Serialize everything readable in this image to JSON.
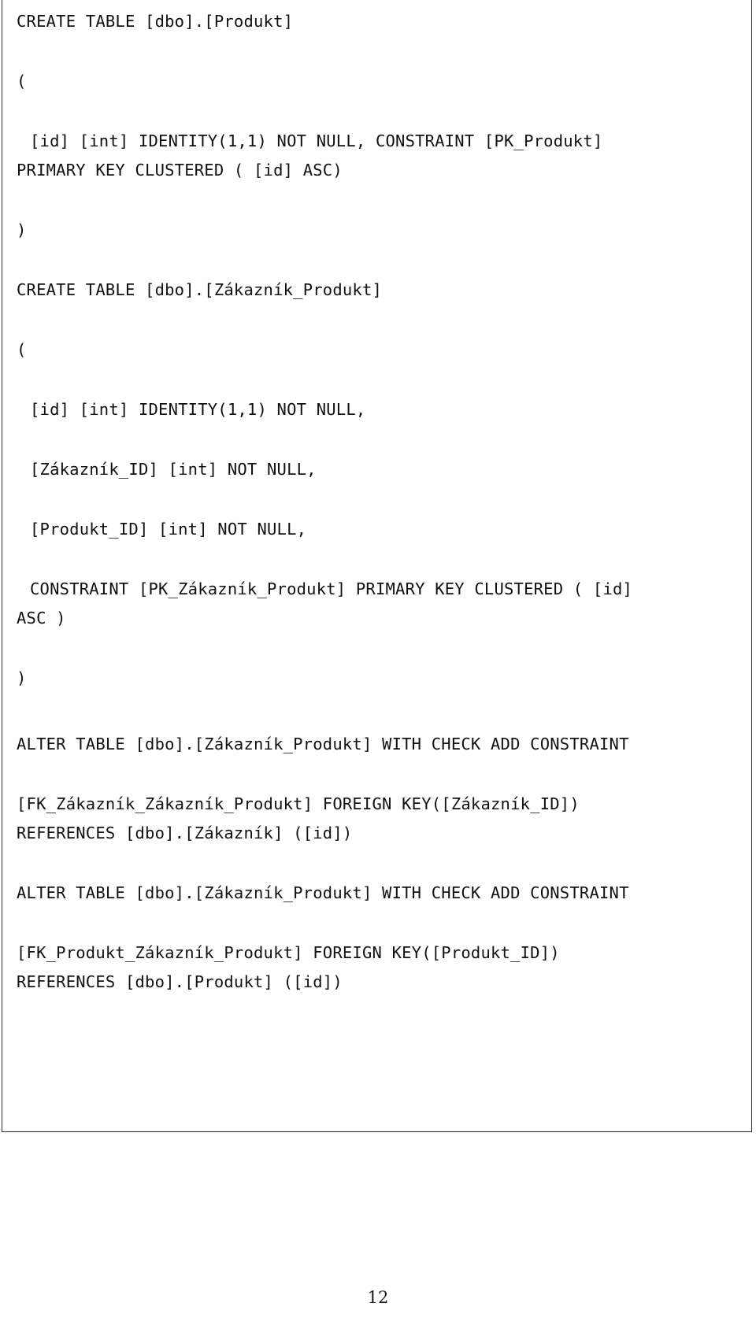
{
  "document": {
    "page_number": "12",
    "frame": {
      "border_color": "#2b2b2b",
      "background_color": "#ffffff"
    },
    "text_color": "#111111"
  },
  "code": {
    "language": "sql",
    "blocks": [
      {
        "name": "create-table-produkt",
        "lines": [
          {
            "text": "CREATE TABLE [dbo].[Produkt]",
            "indent": 0,
            "wrap": false
          },
          {
            "text": "(",
            "indent": 0,
            "wrap": false
          },
          {
            "text": "[id] [int] IDENTITY(1,1) NOT NULL, CONSTRAINT [PK_Produkt]",
            "indent": 1,
            "wrap": false
          },
          {
            "text": "PRIMARY KEY CLUSTERED ( [id] ASC)",
            "indent": 0,
            "wrap": true
          },
          {
            "text": ")",
            "indent": 0,
            "wrap": false
          }
        ]
      },
      {
        "name": "create-table-zakaznik-produkt",
        "lines": [
          {
            "text": "CREATE TABLE [dbo].[Zákazník_Produkt]",
            "indent": 0,
            "wrap": false
          },
          {
            "text": "(",
            "indent": 0,
            "wrap": false
          },
          {
            "text": "[id] [int] IDENTITY(1,1) NOT NULL,",
            "indent": 1,
            "wrap": false
          },
          {
            "text": "[Zákazník_ID] [int] NOT NULL,",
            "indent": 1,
            "wrap": false
          },
          {
            "text": "[Produkt_ID] [int] NOT NULL,",
            "indent": 1,
            "wrap": false
          },
          {
            "text": "CONSTRAINT [PK_Zákazník_Produkt] PRIMARY KEY CLUSTERED ( [id]",
            "indent": 1,
            "wrap": false
          },
          {
            "text": "ASC )",
            "indent": 0,
            "wrap": true
          },
          {
            "text": ")",
            "indent": 0,
            "wrap": false
          }
        ]
      },
      {
        "name": "alter-table-fk-zakaznik",
        "lines": [
          {
            "text": "ALTER TABLE [dbo].[Zákazník_Produkt] WITH CHECK ADD CONSTRAINT",
            "indent": 0,
            "wrap": false
          },
          {
            "text": "[FK_Zákazník_Zákazník_Produkt] FOREIGN KEY([Zákazník_ID])",
            "indent": 0,
            "wrap": false
          },
          {
            "text": "REFERENCES [dbo].[Zákazník] ([id])",
            "indent": 0,
            "wrap": true
          }
        ]
      },
      {
        "name": "alter-table-fk-produkt",
        "lines": [
          {
            "text": "ALTER TABLE [dbo].[Zákazník_Produkt] WITH CHECK ADD CONSTRAINT",
            "indent": 0,
            "wrap": false
          },
          {
            "text": "[FK_Produkt_Zákazník_Produkt] FOREIGN KEY([Produkt_ID])",
            "indent": 0,
            "wrap": false
          },
          {
            "text": "REFERENCES [dbo].[Produkt] ([id])",
            "indent": 0,
            "wrap": true
          }
        ]
      }
    ]
  }
}
